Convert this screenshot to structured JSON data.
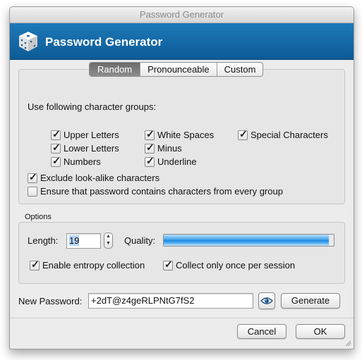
{
  "window": {
    "title": "Password Generator"
  },
  "header": {
    "title": "Password Generator",
    "icon": "dice-icon"
  },
  "tabs": [
    {
      "label": "Random",
      "active": true
    },
    {
      "label": "Pronounceable",
      "active": false
    },
    {
      "label": "Custom",
      "active": false
    }
  ],
  "groups": {
    "heading": "Use following character groups:",
    "items": [
      {
        "label": "Upper Letters",
        "checked": true
      },
      {
        "label": "Lower Letters",
        "checked": true
      },
      {
        "label": "Numbers",
        "checked": true
      },
      {
        "label": "White Spaces",
        "checked": true
      },
      {
        "label": "Minus",
        "checked": true
      },
      {
        "label": "Underline",
        "checked": true
      },
      {
        "label": "Special Characters",
        "checked": true
      }
    ],
    "exclude_lookalike": {
      "label": "Exclude look-alike characters",
      "checked": true
    },
    "ensure_every_group": {
      "label": "Ensure that password contains characters from every group",
      "checked": false
    }
  },
  "options": {
    "title": "Options",
    "length_label": "Length:",
    "length_value": "19",
    "quality_label": "Quality:",
    "quality_fraction": 0.97,
    "entropy": {
      "label": "Enable entropy collection",
      "checked": true
    },
    "collect_once": {
      "label": "Collect only once per session",
      "checked": true
    }
  },
  "new_password": {
    "label": "New Password:",
    "value": "+2dT@z4geRLPNtG7fS2",
    "generate_label": "Generate"
  },
  "buttons": {
    "cancel": "Cancel",
    "ok": "OK"
  }
}
